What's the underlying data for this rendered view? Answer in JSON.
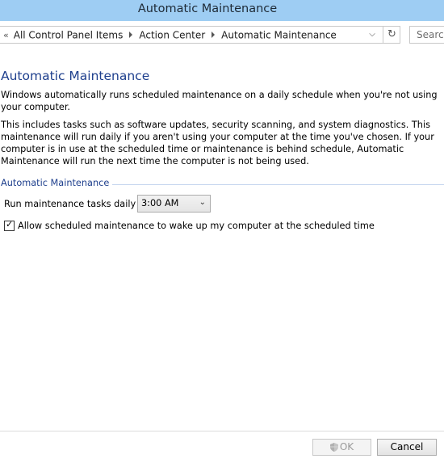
{
  "window": {
    "title": "Automatic Maintenance"
  },
  "address_bar": {
    "breadcrumbs": [
      "All Control Panel Items",
      "Action Center",
      "Automatic Maintenance"
    ],
    "search_placeholder": "Search"
  },
  "main": {
    "heading": "Automatic Maintenance",
    "paragraph1": "Windows automatically runs scheduled maintenance on a daily schedule when you're not using your computer.",
    "paragraph2": "This includes tasks such as software updates, security scanning, and system diagnostics. This maintenance will run daily if you aren't using your computer at the time you've chosen. If your computer is in use at the scheduled time or maintenance is behind schedule, Automatic Maintenance will run the next time the computer is not being used.",
    "group_label": "Automatic Maintenance",
    "run_label": "Run maintenance tasks daily at",
    "time_value": "3:00 AM",
    "wake_checkbox_label": "Allow scheduled maintenance to wake up my computer at the scheduled time",
    "wake_checked": true
  },
  "footer": {
    "ok_label": "OK",
    "cancel_label": "Cancel"
  }
}
